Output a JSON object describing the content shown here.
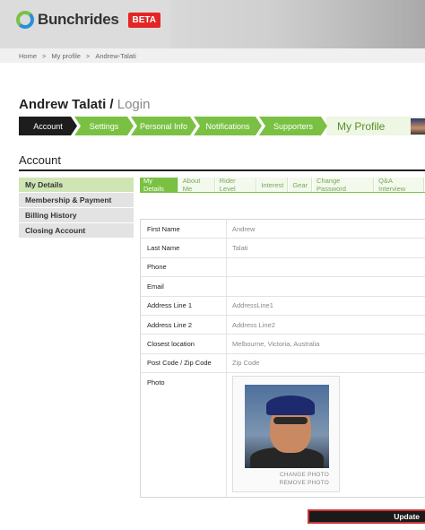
{
  "header": {
    "logo_text": "Bunchrides",
    "beta_badge": "BETA"
  },
  "breadcrumb": [
    "Home",
    ">",
    "My profile",
    ">",
    "Andrew-Talati"
  ],
  "title": {
    "name": "Andrew Talati /",
    "login": "Login"
  },
  "tabs": [
    {
      "label": "Account",
      "active": true
    },
    {
      "label": "Settings"
    },
    {
      "label": "Personal Info"
    },
    {
      "label": "Notifications"
    },
    {
      "label": "Supporters"
    }
  ],
  "profile_tab": "My Profile",
  "section_title": "Account",
  "side_menu": [
    {
      "label": "My Details",
      "active": true
    },
    {
      "label": "Membership & Payment"
    },
    {
      "label": "Billing History"
    },
    {
      "label": "Closing Account"
    }
  ],
  "sub_tabs": [
    {
      "label": "My Details",
      "active": true
    },
    {
      "label": "About Me"
    },
    {
      "label": "Rider Level"
    },
    {
      "label": "Interest"
    },
    {
      "label": "Gear"
    },
    {
      "label": "Change Password"
    },
    {
      "label": "Q&A Interview"
    }
  ],
  "form": [
    {
      "label": "First Name",
      "value": "Andrew"
    },
    {
      "label": "Last Name",
      "value": "Talati"
    },
    {
      "label": "Phone",
      "value": ""
    },
    {
      "label": "Email",
      "value": ""
    },
    {
      "label": "Address Line 1",
      "value": "AddressLine1"
    },
    {
      "label": "Address Line 2",
      "value": "Address Line2"
    },
    {
      "label": "Closest location",
      "value": "Melbourne, Victoria, Australia"
    },
    {
      "label": "Post Code / Zip Code",
      "value": "Zip Code"
    }
  ],
  "photo": {
    "label": "Photo",
    "change_link": "CHANGE PHOTO",
    "remove_link": "REMOVE PHOTO"
  },
  "update_button": "Update",
  "colors": {
    "brand_green": "#7ac143",
    "dark_tab": "#1d1d1d",
    "beta_red": "#e32526"
  }
}
